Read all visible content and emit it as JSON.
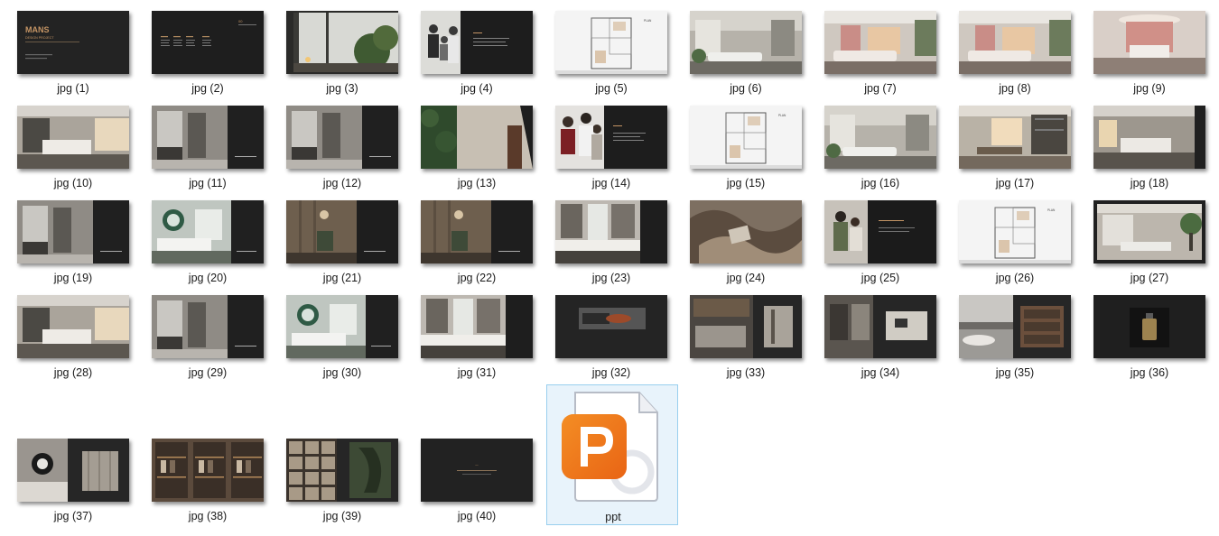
{
  "files": [
    {
      "label": "jpg (1)",
      "style": "cover",
      "title": "MANS",
      "subtitle": "DESIGN PROJECT"
    },
    {
      "label": "jpg (2)",
      "style": "toc",
      "chapter": "00"
    },
    {
      "label": "jpg (3)",
      "style": "photo-window"
    },
    {
      "label": "jpg (4)",
      "style": "photo-family"
    },
    {
      "label": "jpg (5)",
      "style": "plan",
      "plan_label": "PLAN"
    },
    {
      "label": "jpg (6)",
      "style": "photo-living"
    },
    {
      "label": "jpg (7)",
      "style": "photo-pink"
    },
    {
      "label": "jpg (8)",
      "style": "photo-pink"
    },
    {
      "label": "jpg (9)",
      "style": "photo-pinkbed"
    },
    {
      "label": "jpg (10)",
      "style": "photo-bedroom"
    },
    {
      "label": "jpg (11)",
      "style": "photo-bath-dark"
    },
    {
      "label": "jpg (12)",
      "style": "photo-bath-dark"
    },
    {
      "label": "jpg (13)",
      "style": "photo-green"
    },
    {
      "label": "jpg (14)",
      "style": "photo-family2"
    },
    {
      "label": "jpg (15)",
      "style": "plan",
      "plan_label": "PLAN"
    },
    {
      "label": "jpg (16)",
      "style": "photo-living"
    },
    {
      "label": "jpg (17)",
      "style": "photo-dining"
    },
    {
      "label": "jpg (18)",
      "style": "photo-bedroom-dark"
    },
    {
      "label": "jpg (19)",
      "style": "photo-bath-dark"
    },
    {
      "label": "jpg (20)",
      "style": "photo-kids"
    },
    {
      "label": "jpg (21)",
      "style": "photo-wood-dark"
    },
    {
      "label": "jpg (22)",
      "style": "photo-wood-dark"
    },
    {
      "label": "jpg (23)",
      "style": "photo-kitchen-dark"
    },
    {
      "label": "jpg (24)",
      "style": "photo-fabric"
    },
    {
      "label": "jpg (25)",
      "style": "photo-couple"
    },
    {
      "label": "jpg (26)",
      "style": "plan",
      "plan_label": "PLAN"
    },
    {
      "label": "jpg (27)",
      "style": "photo-living-plant"
    },
    {
      "label": "jpg (28)",
      "style": "photo-bedroom"
    },
    {
      "label": "jpg (29)",
      "style": "photo-bath-dark"
    },
    {
      "label": "jpg (30)",
      "style": "photo-kids"
    },
    {
      "label": "jpg (31)",
      "style": "photo-kitchen-dark"
    },
    {
      "label": "jpg (32)",
      "style": "dark-product"
    },
    {
      "label": "jpg (33)",
      "style": "dark-kitchen-detail"
    },
    {
      "label": "jpg (34)",
      "style": "dark-two-photos"
    },
    {
      "label": "jpg (35)",
      "style": "dark-city"
    },
    {
      "label": "jpg (36)",
      "style": "dark-bottle"
    },
    {
      "label": "jpg (37)",
      "style": "dark-lamp"
    },
    {
      "label": "jpg (38)",
      "style": "dark-wardrobe"
    },
    {
      "label": "jpg (39)",
      "style": "dark-shelves"
    },
    {
      "label": "jpg (40)",
      "style": "dark-end"
    }
  ],
  "ppt": {
    "label": "ppt",
    "icon": "wps-presentation-icon",
    "brand_color": "#ee6a17"
  }
}
